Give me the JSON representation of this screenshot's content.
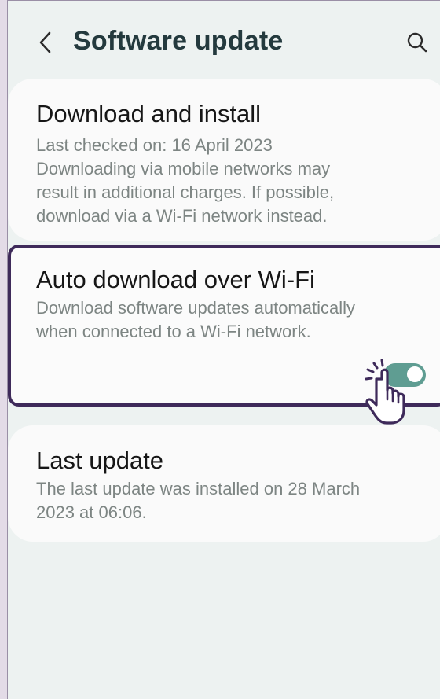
{
  "header": {
    "title": "Software update",
    "back_icon": "chevron-left-icon",
    "search_icon": "search-icon"
  },
  "cards": {
    "download": {
      "title": "Download and install",
      "desc_lines": [
        "Last checked on: 16 April 2023",
        "Downloading via mobile networks may",
        "result in additional charges. If possible,",
        "download via a Wi-Fi network instead."
      ]
    },
    "auto_download": {
      "title": "Auto download over Wi-Fi",
      "desc_lines": [
        "Download software updates automatically",
        "when connected to a Wi-Fi network."
      ],
      "toggle_on": true
    },
    "last_update": {
      "title": "Last update",
      "desc_lines": [
        "The last update was installed on 28 March",
        "2023 at 06:06."
      ]
    }
  },
  "colors": {
    "accent": "#5f9d92",
    "highlight_border": "#3e2a5a",
    "background": "#edf2f1",
    "card": "#fafafa"
  }
}
